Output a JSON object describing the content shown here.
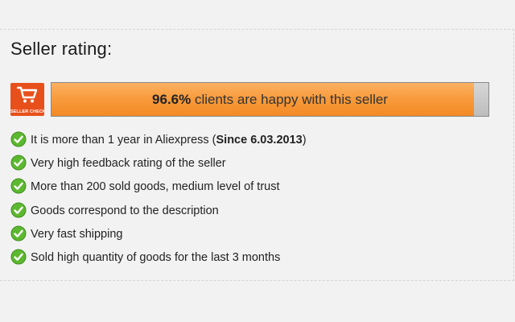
{
  "widget": {
    "title": "Seller rating:",
    "badge": {
      "icon": "shopping-cart-icon",
      "text": "SELLER CHECK",
      "color": "#e8501b"
    },
    "rating": {
      "percent_text": "96.6%",
      "percent_value": 96.6,
      "suffix_text": " clients are happy with this seller",
      "fill_color": "#f89a3b"
    },
    "features": [
      {
        "icon": "green-check-icon",
        "text": "It is more than 1 year in Aliexpress (",
        "bold": "Since 6.03.2013",
        "after": ")"
      },
      {
        "icon": "green-check-icon",
        "text": "Very high feedback rating of the seller"
      },
      {
        "icon": "green-check-icon",
        "text": "More than 200 sold goods, medium level of trust"
      },
      {
        "icon": "green-check-icon",
        "text": "Goods correspond to the description"
      },
      {
        "icon": "green-check-icon",
        "text": "Very fast shipping"
      },
      {
        "icon": "green-check-icon",
        "text": "Sold high quantity of goods for the last 3 months"
      }
    ],
    "check_color": "#5cb830"
  }
}
